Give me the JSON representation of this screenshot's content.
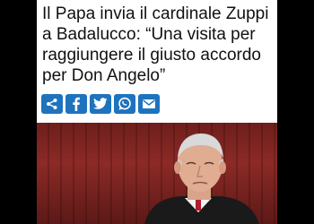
{
  "article": {
    "headline": "Il Papa invia il cardinale Zuppi a Badalucco: “Una visita per raggiungere il giusto accordo per Don Angelo”"
  },
  "share": {
    "buttons": [
      {
        "icon": "share-icon",
        "color": "#1e73be"
      },
      {
        "icon": "facebook-icon",
        "color": "#1e73be"
      },
      {
        "icon": "twitter-icon",
        "color": "#1e73be"
      },
      {
        "icon": "whatsapp-icon",
        "color": "#1e73be"
      },
      {
        "icon": "email-icon",
        "color": "#1e73be"
      }
    ]
  },
  "photo": {
    "subject": "cardinal-portrait"
  },
  "colors": {
    "accent": "#1e73be",
    "background": "#000000",
    "card": "#ffffff"
  }
}
